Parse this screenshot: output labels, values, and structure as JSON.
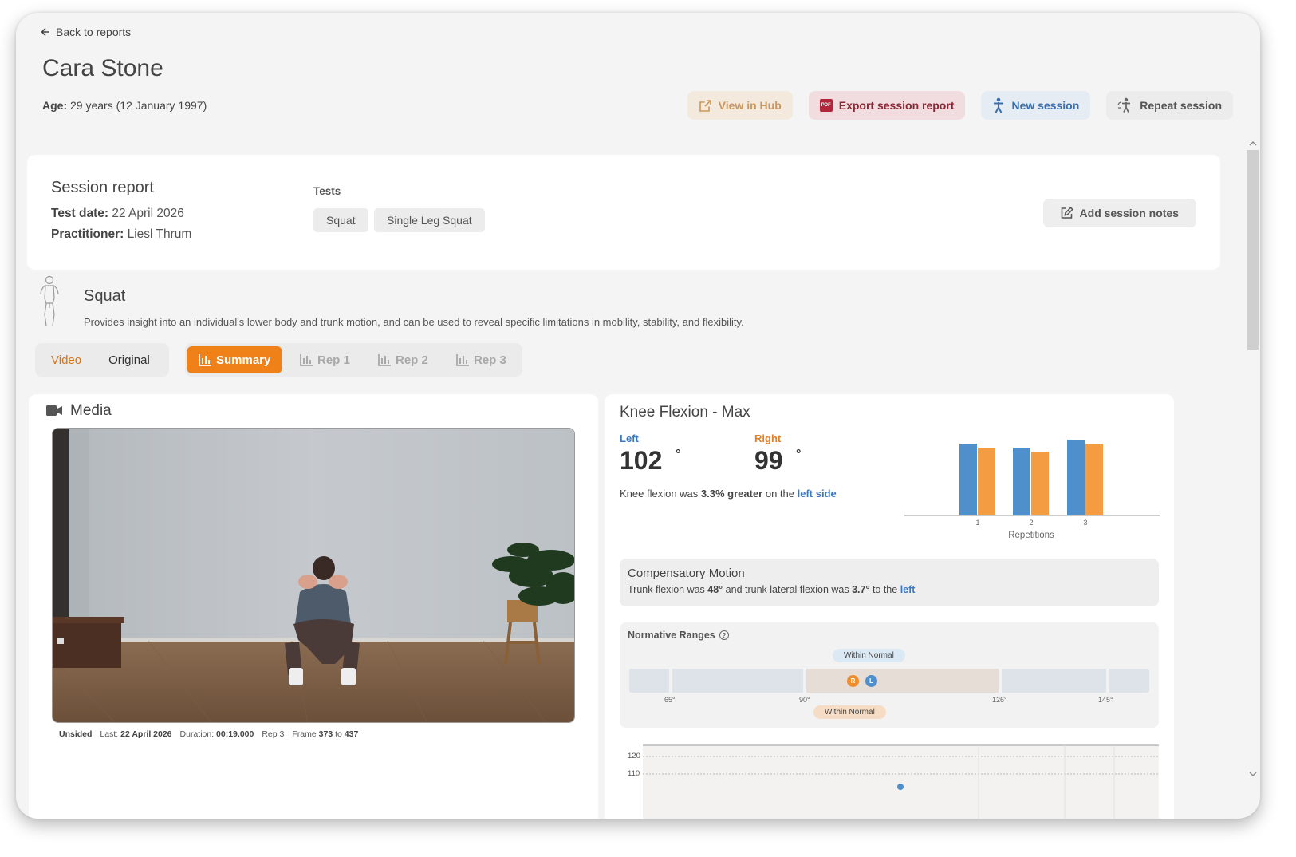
{
  "nav": {
    "back_label": "Back to reports"
  },
  "patient": {
    "name": "Cara Stone",
    "age_label": "Age:",
    "age_value": " 29 years (12 January 1997)"
  },
  "actions": {
    "view_hub": "View in Hub",
    "export": "Export session report",
    "new_session": "New session",
    "repeat_session": "Repeat session"
  },
  "session": {
    "title": "Session report",
    "test_date_label": "Test date:",
    "test_date": " 22 April 2026",
    "practitioner_label": "Practitioner:",
    "practitioner": " Liesl Thrum",
    "tests_label": "Tests",
    "tests": [
      "Squat",
      "Single Leg Squat"
    ],
    "notes_button": "Add session notes"
  },
  "test": {
    "name": "Squat",
    "description": "Provides insight into an individual's lower body and trunk motion, and can be used to reveal specific limitations in mobility, stability, and flexibility."
  },
  "view_toggle": {
    "video": "Video",
    "original": "Original"
  },
  "tabs": [
    "Summary",
    "Rep 1",
    "Rep 2",
    "Rep 3"
  ],
  "media": {
    "title": "Media",
    "meta": {
      "side": "Unsided",
      "last_label": "Last:",
      "last": "22 April 2026",
      "duration_label": "Duration:",
      "duration": "00:19.000",
      "rep": "Rep 3",
      "frame_label": "Frame",
      "frame_from": "373",
      "frame_to_label": "to",
      "frame_to": "437"
    }
  },
  "knee": {
    "title": "Knee Flexion - Max",
    "left_label": "Left",
    "left_value": "102",
    "right_label": "Right",
    "right_value": "99",
    "degree": "°",
    "summary_pre": "Knee flexion was ",
    "summary_bold": "3.3% greater",
    "summary_mid": " on the ",
    "summary_side": "left side",
    "colors": {
      "left": "#4f8fcc",
      "right": "#f39c42",
      "normal_band": "#e5ddd6"
    }
  },
  "chart_data": {
    "type": "bar",
    "categories": [
      "1",
      "2",
      "3"
    ],
    "xlabel": "Repetitions",
    "series": [
      {
        "name": "Left",
        "values": [
          102,
          101,
          103
        ]
      },
      {
        "name": "Right",
        "values": [
          101,
          100,
          102
        ]
      }
    ],
    "ylim": [
      84,
      104
    ],
    "grid": false
  },
  "compensatory": {
    "title": "Compensatory Motion",
    "t1": "Trunk flexion was ",
    "v1": "48°",
    "t2": " and trunk lateral flexion was ",
    "v2": "3.7°",
    "t3": " to the ",
    "side": "left"
  },
  "normative": {
    "title": "Normative Ranges",
    "upper_pill": "Within Normal",
    "lower_pill": "Within Normal",
    "ticks": [
      "65°",
      "90°",
      "126°",
      "145°"
    ],
    "marker_r": "R",
    "marker_l": "L"
  },
  "lower_chart": {
    "y_ticks": [
      "120",
      "110"
    ]
  }
}
